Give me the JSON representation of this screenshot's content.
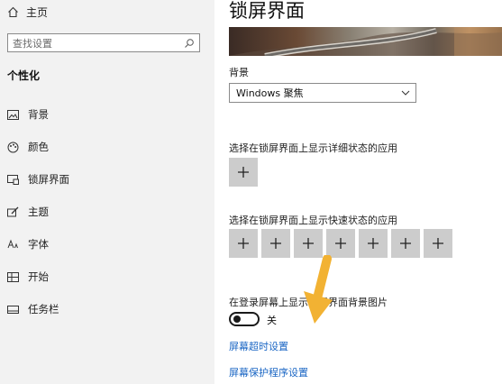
{
  "sidebar": {
    "home_label": "主页",
    "search_placeholder": "查找设置",
    "section_title": "个性化",
    "items": [
      {
        "label": "背景",
        "icon": "picture-icon"
      },
      {
        "label": "颜色",
        "icon": "palette-icon"
      },
      {
        "label": "锁屏界面",
        "icon": "lock-screen-icon"
      },
      {
        "label": "主题",
        "icon": "theme-brush-icon"
      },
      {
        "label": "字体",
        "icon": "font-icon"
      },
      {
        "label": "开始",
        "icon": "start-tiles-icon"
      },
      {
        "label": "任务栏",
        "icon": "taskbar-icon"
      }
    ]
  },
  "main": {
    "title": "锁屏界面",
    "background_label": "背景",
    "background_value": "Windows 聚焦",
    "detailed_status_label": "选择在锁屏界面上显示详细状态的应用",
    "quick_status_label": "选择在锁屏界面上显示快速状态的应用",
    "add_symbol": "+",
    "signin_bg_label": "在登录屏幕上显示锁屏界面背景图片",
    "toggle_state": "关",
    "links": {
      "screen_timeout": "屏幕超时设置",
      "screensaver": "屏幕保护程序设置"
    }
  },
  "colors": {
    "accent_link": "#1a66c4",
    "arrow": "#f2b233",
    "sidebar_bg": "#f2f2f2",
    "add_button_bg": "#cccccc"
  }
}
